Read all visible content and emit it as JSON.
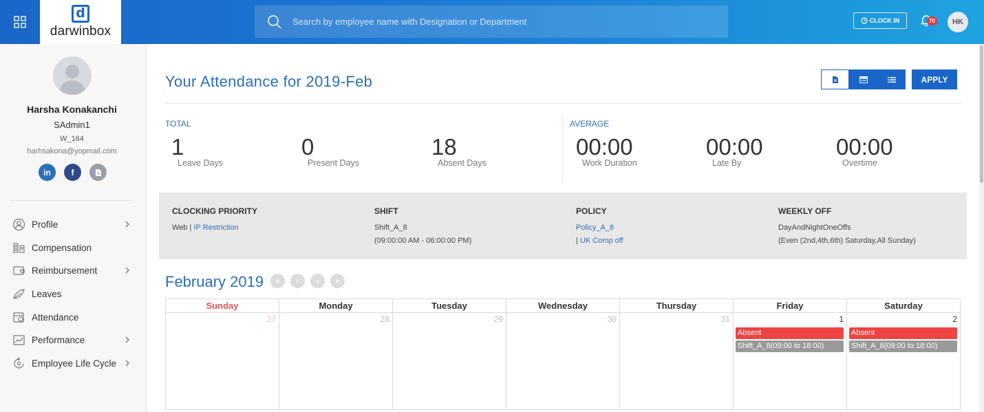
{
  "brand": {
    "logo_mark": "d",
    "logo_text": "darwinbox"
  },
  "search": {
    "placeholder": "Search by employee name with Designation or Department"
  },
  "header": {
    "clock_in_label": "CLOCK IN",
    "notification_count": "70",
    "avatar_initials": "HK"
  },
  "profile": {
    "name": "Harsha Konakanchi",
    "role": "SAdmin1",
    "employee_id": "W_164",
    "email": "harhsakona@yopmail.com"
  },
  "sidebar": {
    "items": [
      {
        "label": "Profile",
        "icon": "profile-icon",
        "has_submenu": true
      },
      {
        "label": "Compensation",
        "icon": "compensation-icon",
        "has_submenu": false
      },
      {
        "label": "Reimbursement",
        "icon": "reimbursement-icon",
        "has_submenu": true
      },
      {
        "label": "Leaves",
        "icon": "leaves-icon",
        "has_submenu": false
      },
      {
        "label": "Attendance",
        "icon": "attendance-icon",
        "has_submenu": false
      },
      {
        "label": "Performance",
        "icon": "performance-icon",
        "has_submenu": true
      },
      {
        "label": "Employee Life Cycle",
        "icon": "life-cycle-icon",
        "has_submenu": true
      }
    ]
  },
  "main": {
    "title": "Your Attendance for 2019-Feb",
    "apply_label": "APPLY",
    "total_label": "TOTAL",
    "average_label": "AVERAGE",
    "totals": [
      {
        "value": "1",
        "label": "Leave Days"
      },
      {
        "value": "0",
        "label": "Present Days"
      },
      {
        "value": "18",
        "label": "Absent Days"
      }
    ],
    "averages": [
      {
        "value": "00:00",
        "label": "Work Duration"
      },
      {
        "value": "00:00",
        "label": "Late By"
      },
      {
        "value": "00:00",
        "label": "Overtime"
      }
    ],
    "info": {
      "clocking_priority": {
        "heading": "CLOCKING PRIORITY",
        "value": "Web",
        "separator": "|",
        "link": "IP Restriction"
      },
      "shift": {
        "heading": "SHIFT",
        "name": "Shift_A_8",
        "timing": "(09:00:00 AM - 06:00:00 PM)"
      },
      "policy": {
        "heading": "POLICY",
        "name": "Policy_A_8",
        "separator": "|",
        "link": "UK Comp off"
      },
      "weekly_off": {
        "heading": "WEEKLY OFF",
        "name": "DayAndNightOneOffs",
        "detail": "(Even (2nd,4th,6th) Saturday,All Sunday)"
      }
    }
  },
  "calendar": {
    "month_title": "February 2019",
    "weekdays": [
      "Sunday",
      "Monday",
      "Tuesday",
      "Wednesday",
      "Thursday",
      "Friday",
      "Saturday"
    ],
    "days": [
      "27",
      "28",
      "29",
      "30",
      "31",
      "1",
      "2"
    ],
    "events": {
      "friday": {
        "status": "Absent",
        "shift": "Shift_A_8(09:00 to 18:00)"
      },
      "saturday": {
        "status": "Absent",
        "shift": "Shift_A_8(09:00 to 18:00)"
      }
    }
  },
  "colors": {
    "brand_blue": "#1a66c8",
    "absent": "#ee4444",
    "shift": "#999999",
    "sunday": "#e05555"
  }
}
